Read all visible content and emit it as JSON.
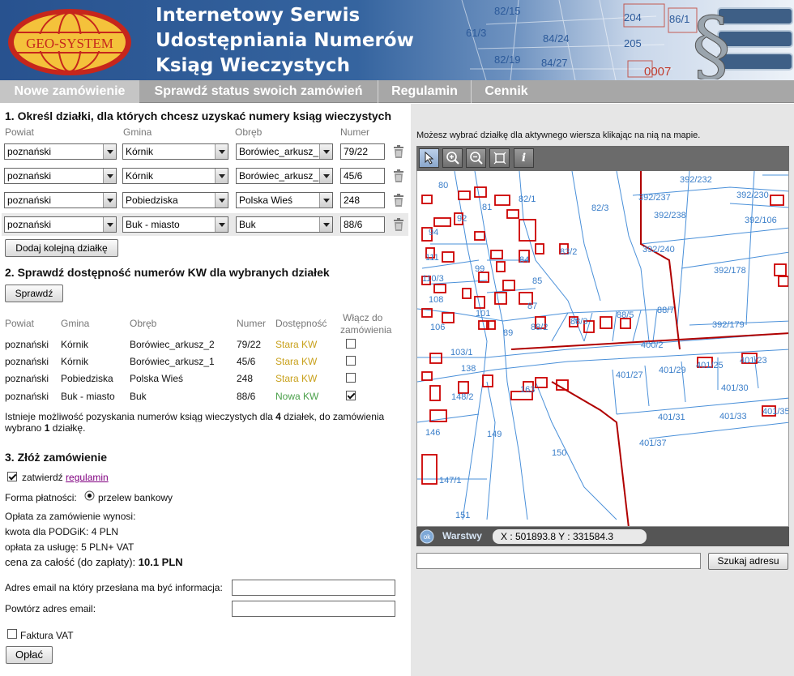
{
  "header": {
    "logo_text": "GEO-SYSTEM",
    "title_lines": [
      "Internetowy Serwis",
      "Udostępniania Numerów",
      "Ksiąg Wieczystych"
    ],
    "bg_map_labels": [
      "82/15",
      "204",
      "86/1",
      "61/3",
      "84/24",
      "205",
      "82/19",
      "84/27",
      "0007"
    ]
  },
  "nav": {
    "tabs": [
      "Nowe zamówienie",
      "Sprawdź status swoich zamówień",
      "Regulamin",
      "Cennik"
    ],
    "active_tab": "Nowe zamówienie"
  },
  "section1": {
    "title": "1. Określ działki, dla których chcesz uzyskać numery ksiąg wieczystych",
    "col_labels": [
      "Powiat",
      "Gmina",
      "Obręb",
      "Numer"
    ],
    "rows": [
      {
        "powiat": "poznański",
        "gmina": "Kórnik",
        "obreb": "Borówiec_arkusz_",
        "numer": "79/22"
      },
      {
        "powiat": "poznański",
        "gmina": "Kórnik",
        "obreb": "Borówiec_arkusz_",
        "numer": "45/6"
      },
      {
        "powiat": "poznański",
        "gmina": "Pobiedziska",
        "obreb": "Polska Wieś",
        "numer": "248"
      },
      {
        "powiat": "poznański",
        "gmina": "Buk - miasto",
        "obreb": "Buk",
        "numer": "88/6"
      }
    ],
    "add_button": "Dodaj kolejną działkę"
  },
  "section2": {
    "title": "2. Sprawdź dostępność numerów KW dla wybranych działek",
    "check_button": "Sprawdź",
    "headers": {
      "powiat": "Powiat",
      "gmina": "Gmina",
      "obreb": "Obręb",
      "numer": "Numer",
      "dostepnosc": "Dostępność",
      "wlacz_1": "Włącz do",
      "wlacz_2": "zamówienia"
    },
    "rows": [
      {
        "powiat": "poznański",
        "gmina": "Kórnik",
        "obreb": "Borówiec_arkusz_2",
        "numer": "79/22",
        "dostepnosc": "Stara KW",
        "checked": false
      },
      {
        "powiat": "poznański",
        "gmina": "Kórnik",
        "obreb": "Borówiec_arkusz_1",
        "numer": "45/6",
        "dostepnosc": "Stara KW",
        "checked": false
      },
      {
        "powiat": "poznański",
        "gmina": "Pobiedziska",
        "obreb": "Polska Wieś",
        "numer": "248",
        "dostepnosc": "Stara KW",
        "checked": false
      },
      {
        "powiat": "poznański",
        "gmina": "Buk - miasto",
        "obreb": "Buk",
        "numer": "88/6",
        "dostepnosc": "Nowa KW",
        "checked": true
      }
    ],
    "info_a": "Istnieje możliwość pozyskania numerów ksiąg wieczystych dla ",
    "info_count": "4",
    "info_b": " działek, do zamówienia",
    "info_c": "wybrano ",
    "info_selected": "1",
    "info_d": " działkę."
  },
  "section3": {
    "title": "3. Złóż zamówienie",
    "confirm_label": "zatwierdź ",
    "confirm_link": "regulamin",
    "confirm_checked": true,
    "payment_label": "Forma płatności:",
    "payment_option": "przelew bankowy",
    "fee_heading": "Opłata za zamówienie wynosi:",
    "fee_podgik": "kwota dla PODGiK: 4 PLN",
    "fee_service": "opłata za usługę: 5 PLN+ VAT",
    "total_label": "cena za całość (do zapłaty): ",
    "total_value": "10.1 PLN",
    "email_label": "Adres email na który przesłana ma być informacja:",
    "email_repeat_label": "Powtórz adres email:",
    "email_value": "",
    "email_repeat_value": "",
    "invoice_label": "Faktura VAT",
    "invoice_checked": false,
    "pay_button": "Opłać"
  },
  "map_panel": {
    "hint": "Możesz wybrać działkę dla aktywnego wiersza klikając na nią na mapie.",
    "tools": [
      "pointer-icon",
      "zoom-in-icon",
      "zoom-out-icon",
      "zoom-extent-icon",
      "info-icon"
    ],
    "layers_button": "Warstwy",
    "ok_label": "ok",
    "coords": "X : 501893.8   Y : 331584.3",
    "address_value": "",
    "search_button": "Szukaj adresu",
    "parcel_labels": [
      "80",
      "392/232",
      "392/230",
      "81",
      "82/1",
      "82/3",
      "392/237",
      "392/238",
      "92",
      "392/106",
      "94",
      "83/2",
      "392/240",
      "111",
      "84",
      "99",
      "392/178",
      "110/3",
      "85",
      "108",
      "87",
      "101",
      "88/2",
      "88/3",
      "88/5",
      "88/7",
      "392/179",
      "106",
      "89",
      "400/2",
      "103/1",
      "401/23",
      "401/25",
      "138",
      "401/27",
      "401/29",
      "163",
      "401/30",
      "148/2",
      "401/35",
      "401/31",
      "401/33",
      "146",
      "149",
      "401/37",
      "150",
      "147/1",
      "151"
    ],
    "colors": {
      "parcel_lines": "#4a90d9",
      "building_lines": "#cc0000",
      "road_lines": "#b00000"
    }
  }
}
